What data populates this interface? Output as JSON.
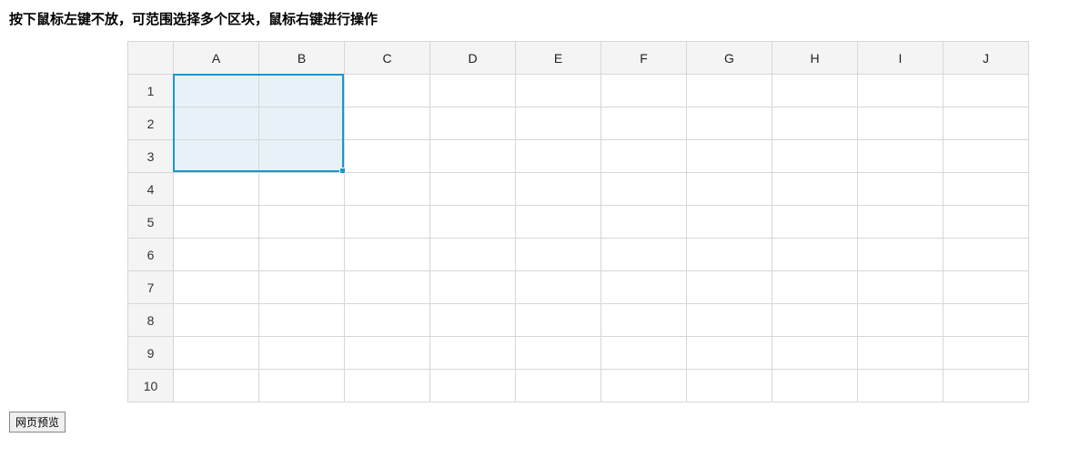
{
  "instruction": "按下鼠标左键不放，可范围选择多个区块，鼠标右键进行操作",
  "sheet": {
    "columns": [
      "A",
      "B",
      "C",
      "D",
      "E",
      "F",
      "G",
      "H",
      "I",
      "J"
    ],
    "rows": [
      "1",
      "2",
      "3",
      "4",
      "5",
      "6",
      "7",
      "8",
      "9",
      "10"
    ],
    "selection": {
      "startCol": 0,
      "endCol": 1,
      "startRow": 0,
      "endRow": 2
    },
    "colors": {
      "selectionBorder": "#1a97c8",
      "selectionFill": "#e6f2f7",
      "headerBg": "#f4f4f4"
    }
  },
  "buttons": {
    "preview": "网页预览"
  }
}
